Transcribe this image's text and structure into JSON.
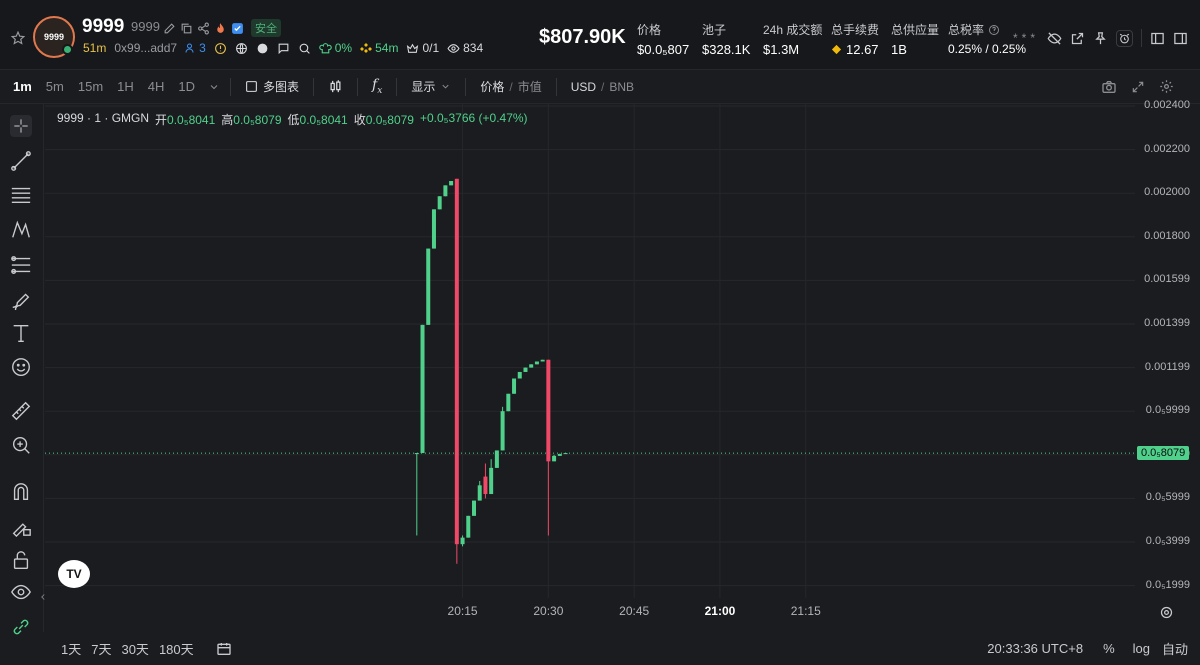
{
  "token": {
    "name": "9999",
    "symbol": "9999",
    "avatar_text": "9999",
    "safe_label": "安全",
    "age": "51m",
    "address": "0x99...add7",
    "holders": "3",
    "pct": "0%",
    "bnb_age": "54m",
    "ratio": "0/1",
    "views": "834"
  },
  "header": {
    "market_cap": "$807.90K",
    "stats": [
      {
        "label": "价格",
        "value": "$0.0₅807"
      },
      {
        "label": "池子",
        "value": "$328.1K"
      },
      {
        "label": "24h 成交额",
        "value": "$1.3M"
      },
      {
        "label": "总手续费",
        "value": "12.67"
      },
      {
        "label": "总供应量",
        "value": "1B"
      },
      {
        "label": "总税率",
        "value": "0.25% / 0.25%"
      }
    ]
  },
  "toolbar": {
    "timeframes": [
      "1m",
      "5m",
      "15m",
      "1H",
      "4H",
      "1D"
    ],
    "active_timeframe": "1m",
    "multi_chart": "多图表",
    "display": "显示",
    "price_label": "价格",
    "mcap_label": "市值",
    "usd_label": "USD",
    "bnb_label": "BNB"
  },
  "legend": {
    "title": "9999 · 1 · GMGN",
    "open_label": "开",
    "open": "0.0₅8041",
    "high_label": "高",
    "high": "0.0₅8079",
    "low_label": "低",
    "low": "0.0₅8041",
    "close_label": "收",
    "close": "0.0₅8079",
    "change": "+0.0₅3766 (+0.47%)"
  },
  "chart_data": {
    "type": "candlestick",
    "y_ticks": [
      "0.002400",
      "0.002200",
      "0.002000",
      "0.001800",
      "0.001599",
      "0.001399",
      "0.001199",
      "0.0₅9999",
      "0.0₅7999",
      "0.0₅5999",
      "0.0₅3999",
      "0.0₅1999"
    ],
    "x_ticks": [
      "20:15",
      "20:30",
      "20:45",
      "21:00",
      "21:15"
    ],
    "current_price_label": "0.0₅8079",
    "candles": [
      {
        "t": "20:07",
        "o": 0.000808,
        "h": 0.000808,
        "l": 0.00043,
        "c": 0.000808
      },
      {
        "t": "20:08",
        "o": 0.000808,
        "h": 0.001396,
        "l": 0.000808,
        "c": 0.001396
      },
      {
        "t": "20:09",
        "o": 0.001396,
        "h": 0.001746,
        "l": 0.001396,
        "c": 0.001746
      },
      {
        "t": "20:10",
        "o": 0.001746,
        "h": 0.001926,
        "l": 0.001746,
        "c": 0.001926
      },
      {
        "t": "20:11",
        "o": 0.001926,
        "h": 0.001986,
        "l": 0.001926,
        "c": 0.001986
      },
      {
        "t": "20:12",
        "o": 0.001986,
        "h": 0.002036,
        "l": 0.001986,
        "c": 0.002036
      },
      {
        "t": "20:13",
        "o": 0.002036,
        "h": 0.002056,
        "l": 0.002036,
        "c": 0.002056
      },
      {
        "t": "20:14",
        "o": 0.002066,
        "h": 0.002066,
        "l": 0.0003,
        "c": 0.00039
      },
      {
        "t": "20:15",
        "o": 0.00039,
        "h": 0.00043,
        "l": 0.00038,
        "c": 0.00042
      },
      {
        "t": "20:16",
        "o": 0.00042,
        "h": 0.00052,
        "l": 0.00042,
        "c": 0.00052
      },
      {
        "t": "20:17",
        "o": 0.00052,
        "h": 0.00059,
        "l": 0.00052,
        "c": 0.00059
      },
      {
        "t": "20:18",
        "o": 0.00059,
        "h": 0.00068,
        "l": 0.00059,
        "c": 0.00066
      },
      {
        "t": "20:19",
        "o": 0.0007,
        "h": 0.00076,
        "l": 0.0006,
        "c": 0.00062
      },
      {
        "t": "20:20",
        "o": 0.00062,
        "h": 0.00078,
        "l": 0.00062,
        "c": 0.00074
      },
      {
        "t": "20:21",
        "o": 0.00074,
        "h": 0.00082,
        "l": 0.00074,
        "c": 0.00082
      },
      {
        "t": "20:22",
        "o": 0.00082,
        "h": 0.00102,
        "l": 0.00082,
        "c": 0.001
      },
      {
        "t": "20:23",
        "o": 0.001,
        "h": 0.00108,
        "l": 0.001,
        "c": 0.00108
      },
      {
        "t": "20:24",
        "o": 0.00108,
        "h": 0.00115,
        "l": 0.00108,
        "c": 0.00115
      },
      {
        "t": "20:25",
        "o": 0.00115,
        "h": 0.00118,
        "l": 0.00115,
        "c": 0.00118
      },
      {
        "t": "20:26",
        "o": 0.00118,
        "h": 0.0012,
        "l": 0.00118,
        "c": 0.0012
      },
      {
        "t": "20:27",
        "o": 0.0012,
        "h": 0.001215,
        "l": 0.0012,
        "c": 0.001215
      },
      {
        "t": "20:28",
        "o": 0.001215,
        "h": 0.001228,
        "l": 0.001215,
        "c": 0.001228
      },
      {
        "t": "20:29",
        "o": 0.001228,
        "h": 0.001236,
        "l": 0.001228,
        "c": 0.001236
      },
      {
        "t": "20:30",
        "o": 0.001236,
        "h": 0.001236,
        "l": 0.00043,
        "c": 0.00077
      },
      {
        "t": "20:31",
        "o": 0.00077,
        "h": 0.0008,
        "l": 0.00077,
        "c": 0.000795
      },
      {
        "t": "20:32",
        "o": 0.000795,
        "h": 0.000805,
        "l": 0.000795,
        "c": 0.000804
      },
      {
        "t": "20:33",
        "o": 0.0008041,
        "h": 0.0008079,
        "l": 0.0008041,
        "c": 0.0008079
      }
    ],
    "y_range": [
      0.0001,
      0.0025
    ],
    "x_range": [
      "19:02",
      "21:18"
    ]
  },
  "bottom": {
    "ranges": [
      "1天",
      "7天",
      "30天",
      "180天"
    ],
    "clock": "20:33:36 UTC+8",
    "pct": "%",
    "log": "log",
    "auto": "自动"
  },
  "colors": {
    "up": "#4fd18b",
    "down": "#f04866",
    "bg": "#1b1c1f"
  }
}
